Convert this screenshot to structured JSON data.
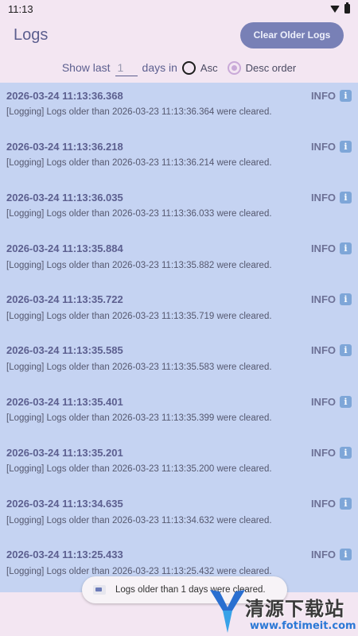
{
  "status_bar": {
    "time": "11:13"
  },
  "header": {
    "title": "Logs",
    "clear_button": "Clear Older Logs"
  },
  "filter": {
    "show_last_label": "Show last",
    "days_value": "1",
    "days_in_label": "days in",
    "asc_label": "Asc",
    "desc_label": "Desc order",
    "selected_order": "desc"
  },
  "logs": [
    {
      "time": "2026-03-24 11:13:36.368",
      "level": "INFO",
      "message": "[Logging] Logs older than 2026-03-23 11:13:36.364 were cleared."
    },
    {
      "time": "2026-03-24 11:13:36.218",
      "level": "INFO",
      "message": "[Logging] Logs older than 2026-03-23 11:13:36.214 were cleared."
    },
    {
      "time": "2026-03-24 11:13:36.035",
      "level": "INFO",
      "message": "[Logging] Logs older than 2026-03-23 11:13:36.033 were cleared."
    },
    {
      "time": "2026-03-24 11:13:35.884",
      "level": "INFO",
      "message": "[Logging] Logs older than 2026-03-23 11:13:35.882 were cleared."
    },
    {
      "time": "2026-03-24 11:13:35.722",
      "level": "INFO",
      "message": "[Logging] Logs older than 2026-03-23 11:13:35.719 were cleared."
    },
    {
      "time": "2026-03-24 11:13:35.585",
      "level": "INFO",
      "message": "[Logging] Logs older than 2026-03-23 11:13:35.583 were cleared."
    },
    {
      "time": "2026-03-24 11:13:35.401",
      "level": "INFO",
      "message": "[Logging] Logs older than 2026-03-23 11:13:35.399 were cleared."
    },
    {
      "time": "2026-03-24 11:13:35.201",
      "level": "INFO",
      "message": "[Logging] Logs older than 2026-03-23 11:13:35.200 were cleared."
    },
    {
      "time": "2026-03-24 11:13:34.635",
      "level": "INFO",
      "message": "[Logging] Logs older than 2026-03-23 11:13:34.632 were cleared."
    },
    {
      "time": "2026-03-24 11:13:25.433",
      "level": "INFO",
      "message": "[Logging] Logs older than 2026-03-23 11:13:25.432 were cleared."
    }
  ],
  "toast": {
    "message": "Logs older than 1 days were cleared."
  },
  "watermark": {
    "title": "清源下载站",
    "url": "www.fotimeit.com"
  },
  "colors": {
    "accent": "#7880b6",
    "list_bg": "#c5d3f2",
    "page_bg": "#f3e6f2"
  },
  "icons": {
    "level_icon": "info-icon"
  }
}
